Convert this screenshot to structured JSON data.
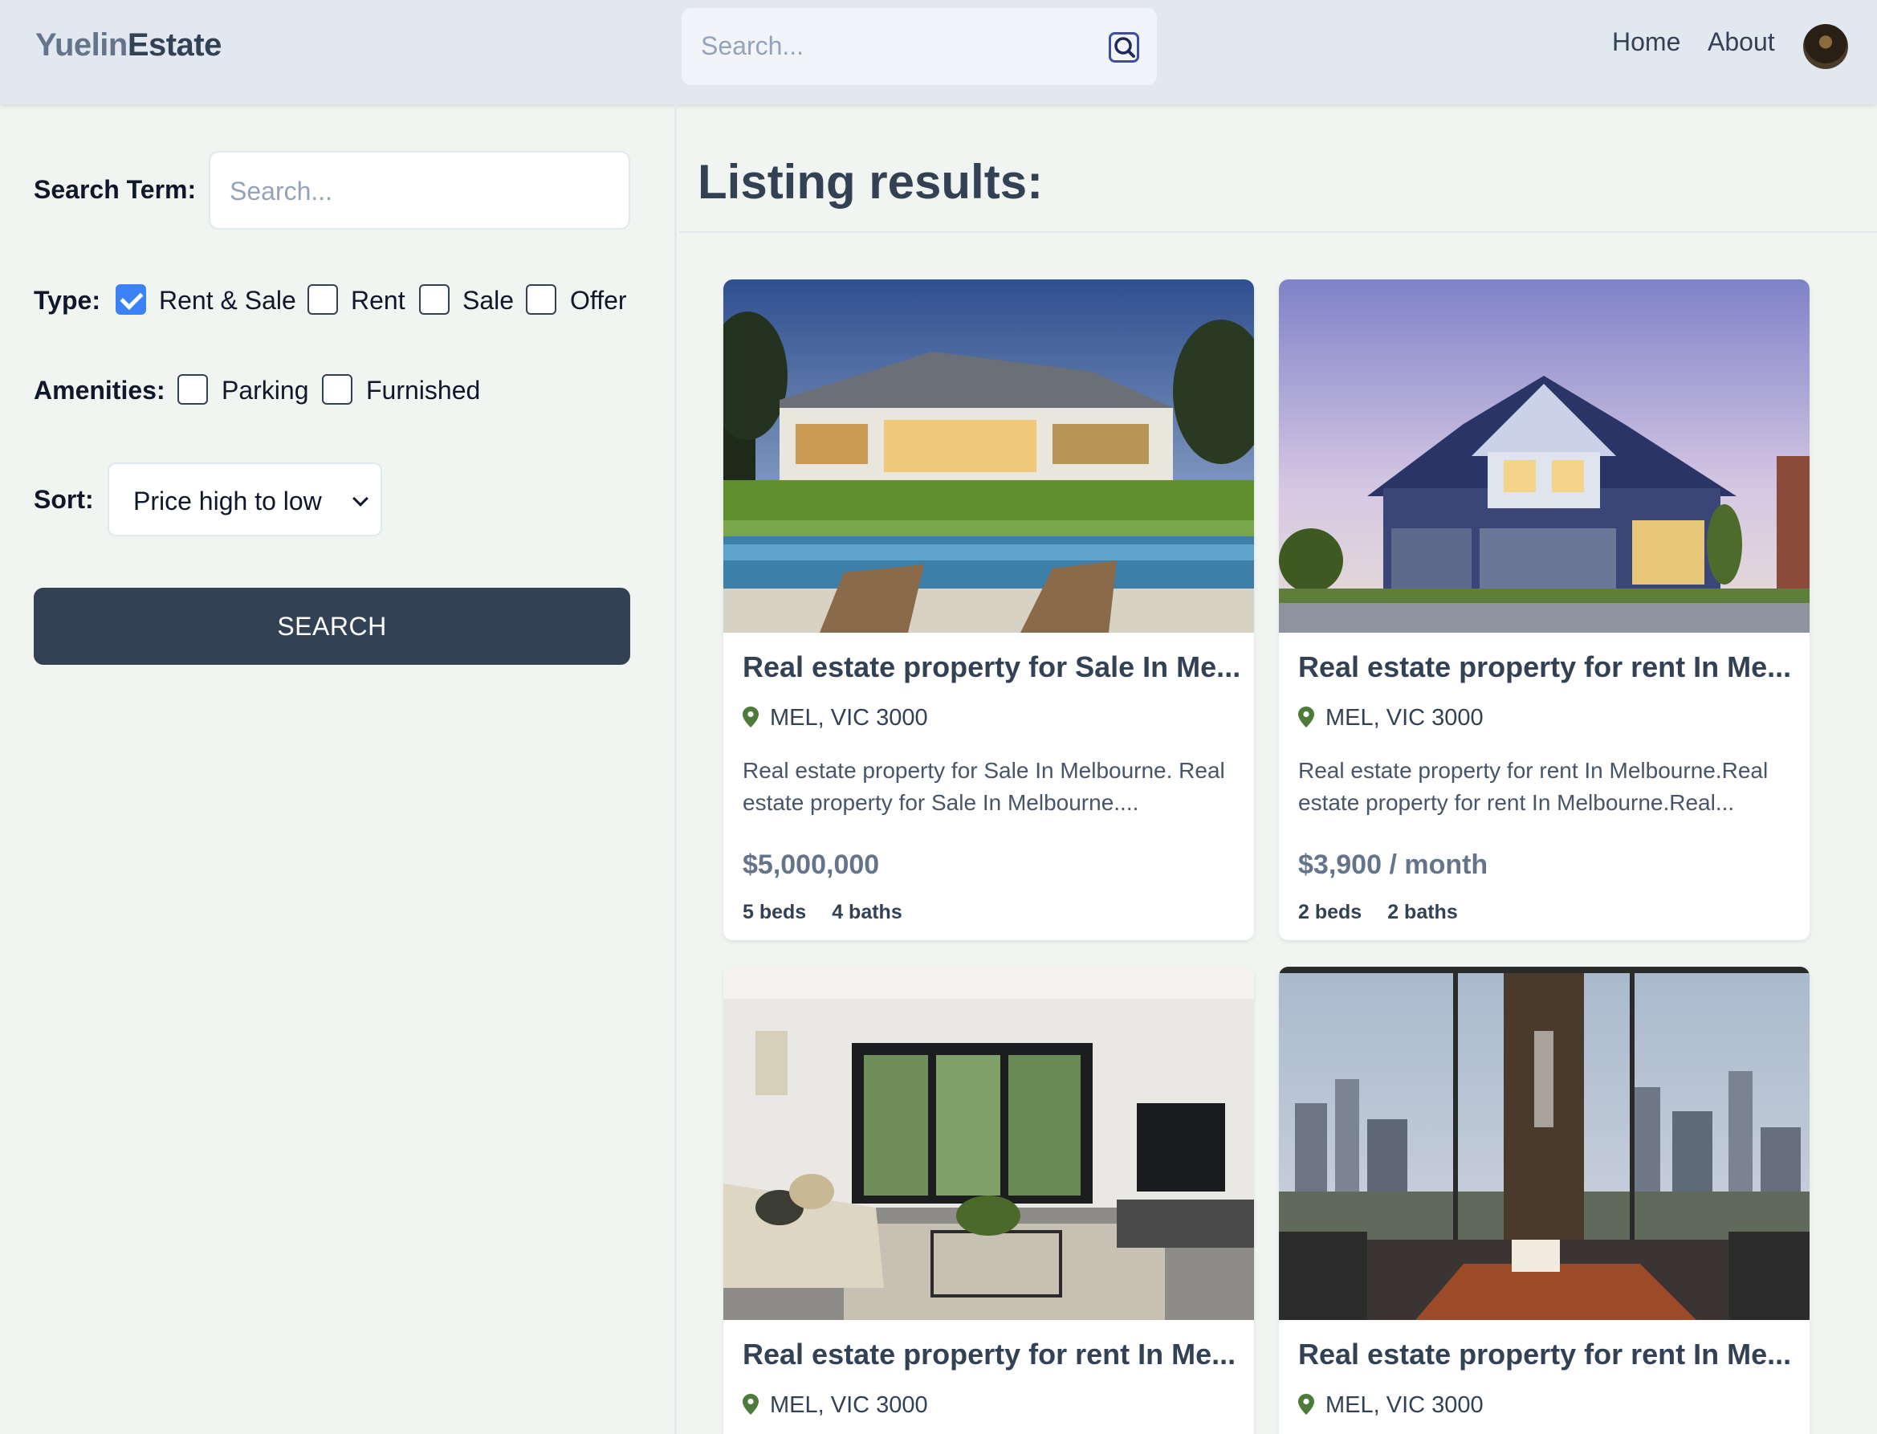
{
  "header": {
    "logo_part1": "Yuelin",
    "logo_part2": "Estate",
    "search_placeholder": "Search...",
    "search_icon": "search-icon",
    "nav": {
      "home": "Home",
      "about": "About"
    }
  },
  "sidebar": {
    "search_term_label": "Search Term:",
    "search_term_placeholder": "Search...",
    "type_label": "Type:",
    "type_options": [
      {
        "label": "Rent & Sale",
        "checked": true
      },
      {
        "label": "Rent",
        "checked": false
      },
      {
        "label": "Sale",
        "checked": false
      },
      {
        "label": "Offer",
        "checked": false
      }
    ],
    "amenities_label": "Amenities:",
    "amenities_options": [
      {
        "label": "Parking",
        "checked": false
      },
      {
        "label": "Furnished",
        "checked": false
      }
    ],
    "sort_label": "Sort:",
    "sort_value": "Price high to low",
    "search_button": "SEARCH"
  },
  "main": {
    "title": "Listing results:",
    "listings": [
      {
        "title": "Real estate property for Sale In Me...",
        "location": "MEL, VIC 3000",
        "description": "Real estate property for Sale In Melbourne. Real estate property for Sale In Melbourne....",
        "price": "$5,000,000",
        "beds": "5 beds",
        "baths": "4 baths"
      },
      {
        "title": "Real estate property for rent In Me...",
        "location": "MEL, VIC 3000",
        "description": "Real estate property for rent In Melbourne.Real estate property for rent In Melbourne.Real...",
        "price": "$3,900 / month",
        "beds": "2 beds",
        "baths": "2 baths"
      },
      {
        "title": "Real estate property for rent In Me...",
        "location": "MEL, VIC 3000"
      },
      {
        "title": "Real estate property for rent In Me...",
        "location": "MEL, VIC 3000"
      }
    ]
  },
  "colors": {
    "accent": "#3b82f6",
    "button": "#334155",
    "header_bg": "#e2e8f0",
    "page_bg": "#f1f5f1",
    "pin": "#4d7c3a"
  }
}
